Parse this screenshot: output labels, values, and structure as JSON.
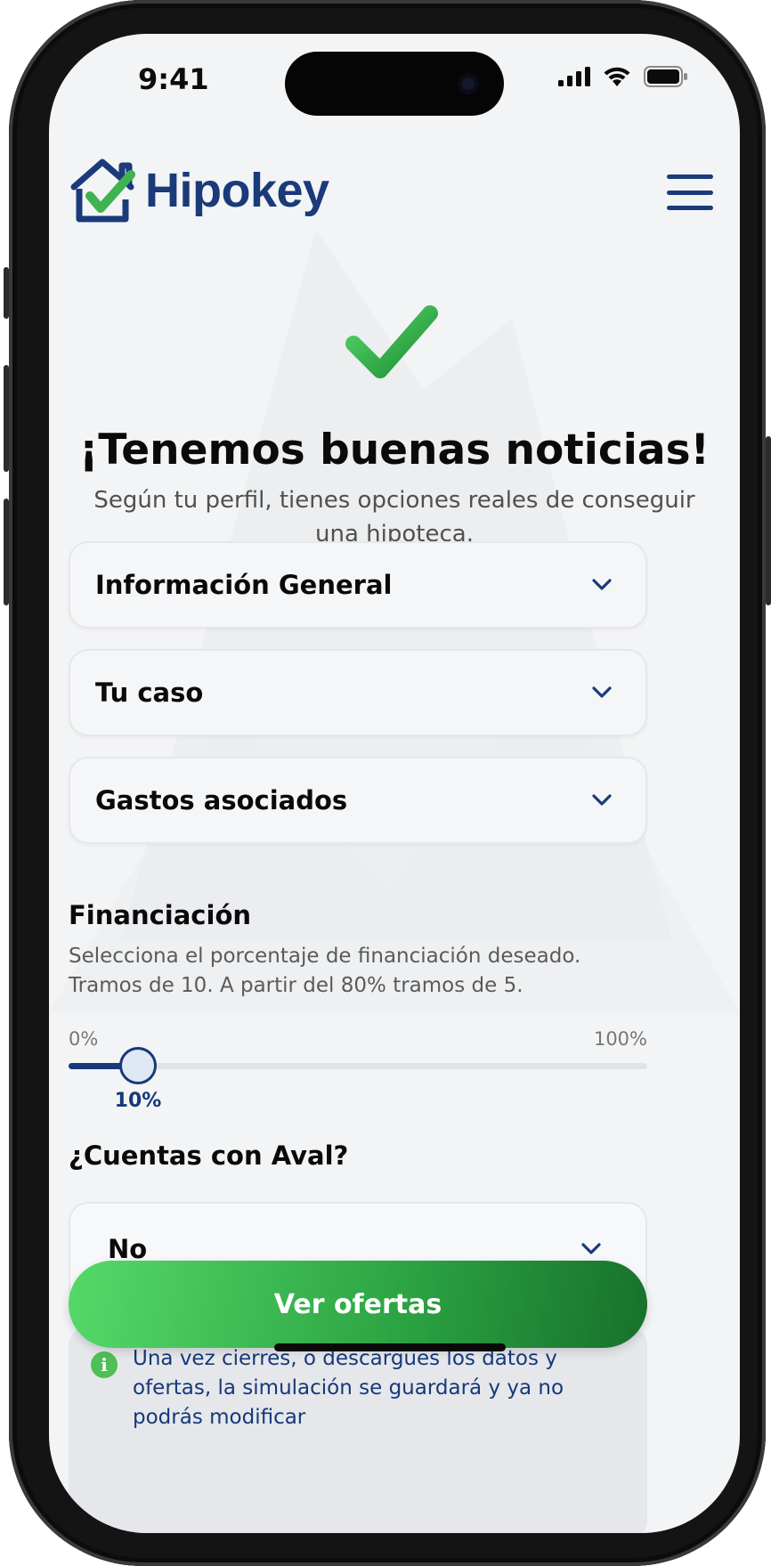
{
  "status_bar": {
    "time": "9:41"
  },
  "header": {
    "brand": "Hipokey"
  },
  "hero": {
    "title": "¡Tenemos buenas noticias!",
    "subtitle": "Según tu perfil, tienes opciones reales de conseguir una hipoteca."
  },
  "accordions": [
    {
      "label": "Información General"
    },
    {
      "label": "Tu caso"
    },
    {
      "label": "Gastos asociados"
    }
  ],
  "financing": {
    "title": "Financiación",
    "description_line1": "Selecciona el porcentaje de financiación deseado.",
    "description_line2": "Tramos de 10. A partir del 80% tramos de 5.",
    "min_label": "0%",
    "max_label": "100%",
    "value": 10,
    "value_label": "10%"
  },
  "guarantor": {
    "title": "¿Cuentas con Aval?",
    "selected": "No"
  },
  "notice": {
    "text": "Una vez cierres, o descargues los datos y ofertas, la simulación se guardará y ya no podrás modificar"
  },
  "cta": {
    "label": "Ver ofertas"
  },
  "colors": {
    "brand": "#1a3a7a",
    "accent": "#2ea644",
    "text": "#0a0a0a"
  },
  "icons": [
    "house-check-logo-icon",
    "hamburger-menu-icon",
    "success-check-icon",
    "chevron-down-icon",
    "info-icon",
    "cellular-signal-icon",
    "wifi-icon",
    "battery-icon"
  ]
}
